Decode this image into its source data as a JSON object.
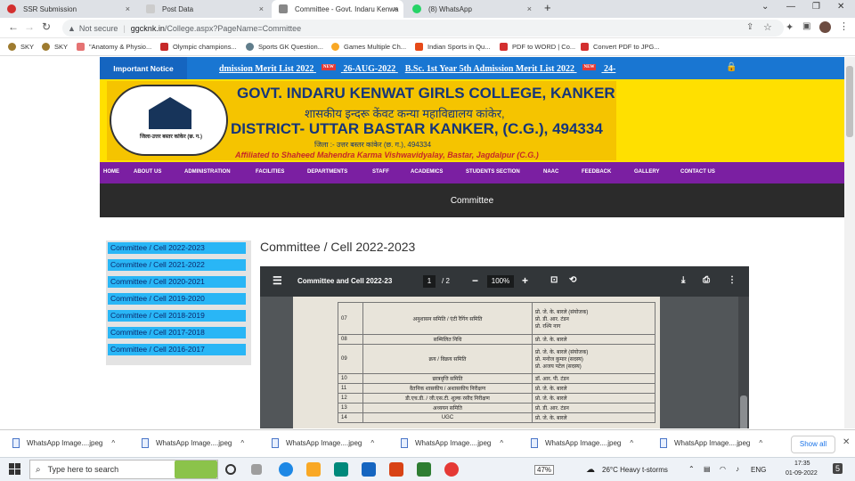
{
  "browser": {
    "tabs": [
      {
        "label": "SSR Submission",
        "close": "×"
      },
      {
        "label": "Post Data",
        "close": "×"
      },
      {
        "label": "Committee - Govt. Indaru Kenwa",
        "close": "×"
      },
      {
        "label": "(8) WhatsApp",
        "close": "×"
      }
    ],
    "new_tab": "+",
    "url_prefix": "Not secure",
    "url_domain": "ggcknk.in",
    "url_path": "/College.aspx?PageName=Committee",
    "bookmarks": [
      "SKY",
      "SKY",
      "\"Anatomy & Physio...",
      "Olympic champions...",
      "Sports GK Question...",
      "Games Multiple Ch...",
      "Indian Sports in Qu...",
      "PDF to WORD | Co...",
      "Convert PDF to JPG..."
    ]
  },
  "site": {
    "notice_label": "Important Notice",
    "notice_text_1": "dmission Merit List 2022",
    "notice_text_2": "26-AUG-2022",
    "notice_text_3": "B.Sc. 1st Year 5th Admission Merit List 2022",
    "notice_text_4": "24-",
    "new_badge": "NEW",
    "banner_title_1": "GOVT. INDARU KENWAT GIRLS COLLEGE, KANKER",
    "banner_title_2": "शासकीय इन्दरू केंवट कन्या महाविद्यालय कांकेर,",
    "banner_title_3": "DISTRICT- UTTAR BASTAR KANKER, (C.G.), 494334",
    "banner_title_4": "जिला :- उत्तर बस्तर कांकेर (छ. ग.), 494334",
    "banner_title_5": "Affiliated to Shaheed Mahendra Karma Vishwavidyalay, Bastar, Jagdalpur (C.G.)",
    "logo_caption": "जिला-उत्तर बस्तर कांकेर (छ. ग.)",
    "menu": [
      "HOME",
      "ABOUT US",
      "ADMINISTRATION",
      "FACILITIES",
      "DEPARTMENTS",
      "STAFF",
      "ACADEMICS",
      "STUDENTS SECTION",
      "NAAC",
      "FEEDBACK",
      "GALLERY",
      "CONTACT US"
    ],
    "page_title": "Committee",
    "sidebar": [
      "Committee / Cell 2022-2023",
      "Committee / Cell 2021-2022",
      "Committee / Cell 2020-2021",
      "Committee / Cell 2019-2020",
      "Committee / Cell 2018-2019",
      "Committee / Cell 2017-2018",
      "Committee / Cell 2016-2017"
    ],
    "heading": "Committee / Cell 2022-2023"
  },
  "pdf": {
    "title": "Committee and Cell 2022-23",
    "page": "1",
    "pages": "/  2",
    "zoom": "100%",
    "rows": [
      {
        "no": "07",
        "name": "अनुशासन समिति / एंटी रैगिंग समिति",
        "members": "प्रो. जे. के. बारले (संयोजक)\nप्रो. डी. आर. टंडन\nप्रो. रश्मि नाग"
      },
      {
        "no": "08",
        "name": "सम्मिलित निधि",
        "members": "प्रो. जे. के. बारले"
      },
      {
        "no": "09",
        "name": "क्रय / विक्रय समिति",
        "members": "प्रो. जे. के. बारले (संयोजक)\nप्रो. मनोज कुमार (सदस्य)\nप्रो. अजय पटेल (सदस्य)"
      },
      {
        "no": "10",
        "name": "छात्रवृत्ति समिति",
        "members": "डॉ. आर. पी. टंडन"
      },
      {
        "no": "11",
        "name": "वैतनिक शासकीय / अशासकीय निरीक्षण",
        "members": "प्रो. जे. के. बारले"
      },
      {
        "no": "12",
        "name": "डी.एच.डी. / जी.एस.टी. शुल्क रसीद निरीक्षण",
        "members": "प्रो. जे. के. बारले"
      },
      {
        "no": "13",
        "name": "अध्ययन समिति",
        "members": "प्रो. डी. आर. टंडन"
      },
      {
        "no": "14",
        "name": "UGC",
        "members": "प्रो. जे. के. बारले"
      }
    ]
  },
  "downloads": {
    "items": [
      "WhatsApp Image....jpeg",
      "WhatsApp Image....jpeg",
      "WhatsApp Image....jpeg",
      "WhatsApp Image....jpeg",
      "WhatsApp Image....jpeg",
      "WhatsApp Image....jpeg"
    ],
    "show_all": "Show all"
  },
  "taskbar": {
    "search_placeholder": "Type here to search",
    "battery": "47%",
    "weather": "26°C  Heavy t-storms",
    "lang": "ENG",
    "time": "17:35",
    "date": "01-09-2022",
    "notif": "5"
  }
}
